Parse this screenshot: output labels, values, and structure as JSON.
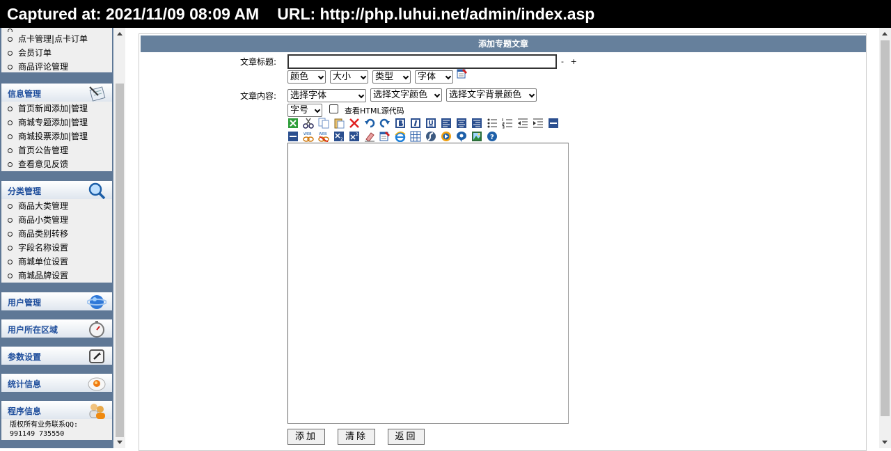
{
  "capture": {
    "captured_label": "Captured at: 2021/11/09 08:09 AM",
    "url_label": "URL: http://php.luhui.net/admin/index.asp"
  },
  "sidebar": {
    "partial_items": [
      "点卡管理|点卡订单",
      "会员订单",
      "商品评论管理"
    ],
    "sections": [
      {
        "title": "信息管理",
        "icon": "writing-pad-icon",
        "items": [
          "首页新闻添加|管理",
          "商城专题添加|管理",
          "商城投票添加|管理",
          "首页公告管理",
          "查看意见反馈"
        ]
      },
      {
        "title": "分类管理",
        "icon": "magnifier-icon",
        "items": [
          "商品大类管理",
          "商品小类管理",
          "商品类别转移",
          "字段名称设置",
          "商城单位设置",
          "商城品牌设置"
        ]
      },
      {
        "title": "用户管理",
        "icon": "globe-icon",
        "items": []
      },
      {
        "title": "用户所在区域",
        "icon": "stopwatch-icon",
        "items": []
      },
      {
        "title": "参数设置",
        "icon": "settings-window-icon",
        "items": []
      },
      {
        "title": "统计信息",
        "icon": "chart-disc-icon",
        "items": []
      },
      {
        "title": "程序信息",
        "icon": "users-icon",
        "items": []
      }
    ],
    "copyright_line1": "版权所有业务联系QQ:",
    "copyright_line2": "991149 735550"
  },
  "form": {
    "panel_title": "添加专题文章",
    "article_title_label": "文章标题:",
    "size_controls": "- +",
    "title_selects": [
      "颜色",
      "大小",
      "类型",
      "字体"
    ],
    "content_label": "文章内容:",
    "font_select": "选择字体",
    "color_select": "选择文字颜色",
    "bgcolor_select": "选择文字背景颜色",
    "fontsize_select": "字号",
    "html_source_label": "查看HTML源代码",
    "buttons": {
      "add": "添加",
      "clear": "清除",
      "back": "返回"
    }
  },
  "colors": {
    "sidebar_bg": "#5f7896",
    "menu_bg": "#efefef",
    "header_text": "#1f4e9c",
    "panel_title_bg": "#66809c"
  }
}
